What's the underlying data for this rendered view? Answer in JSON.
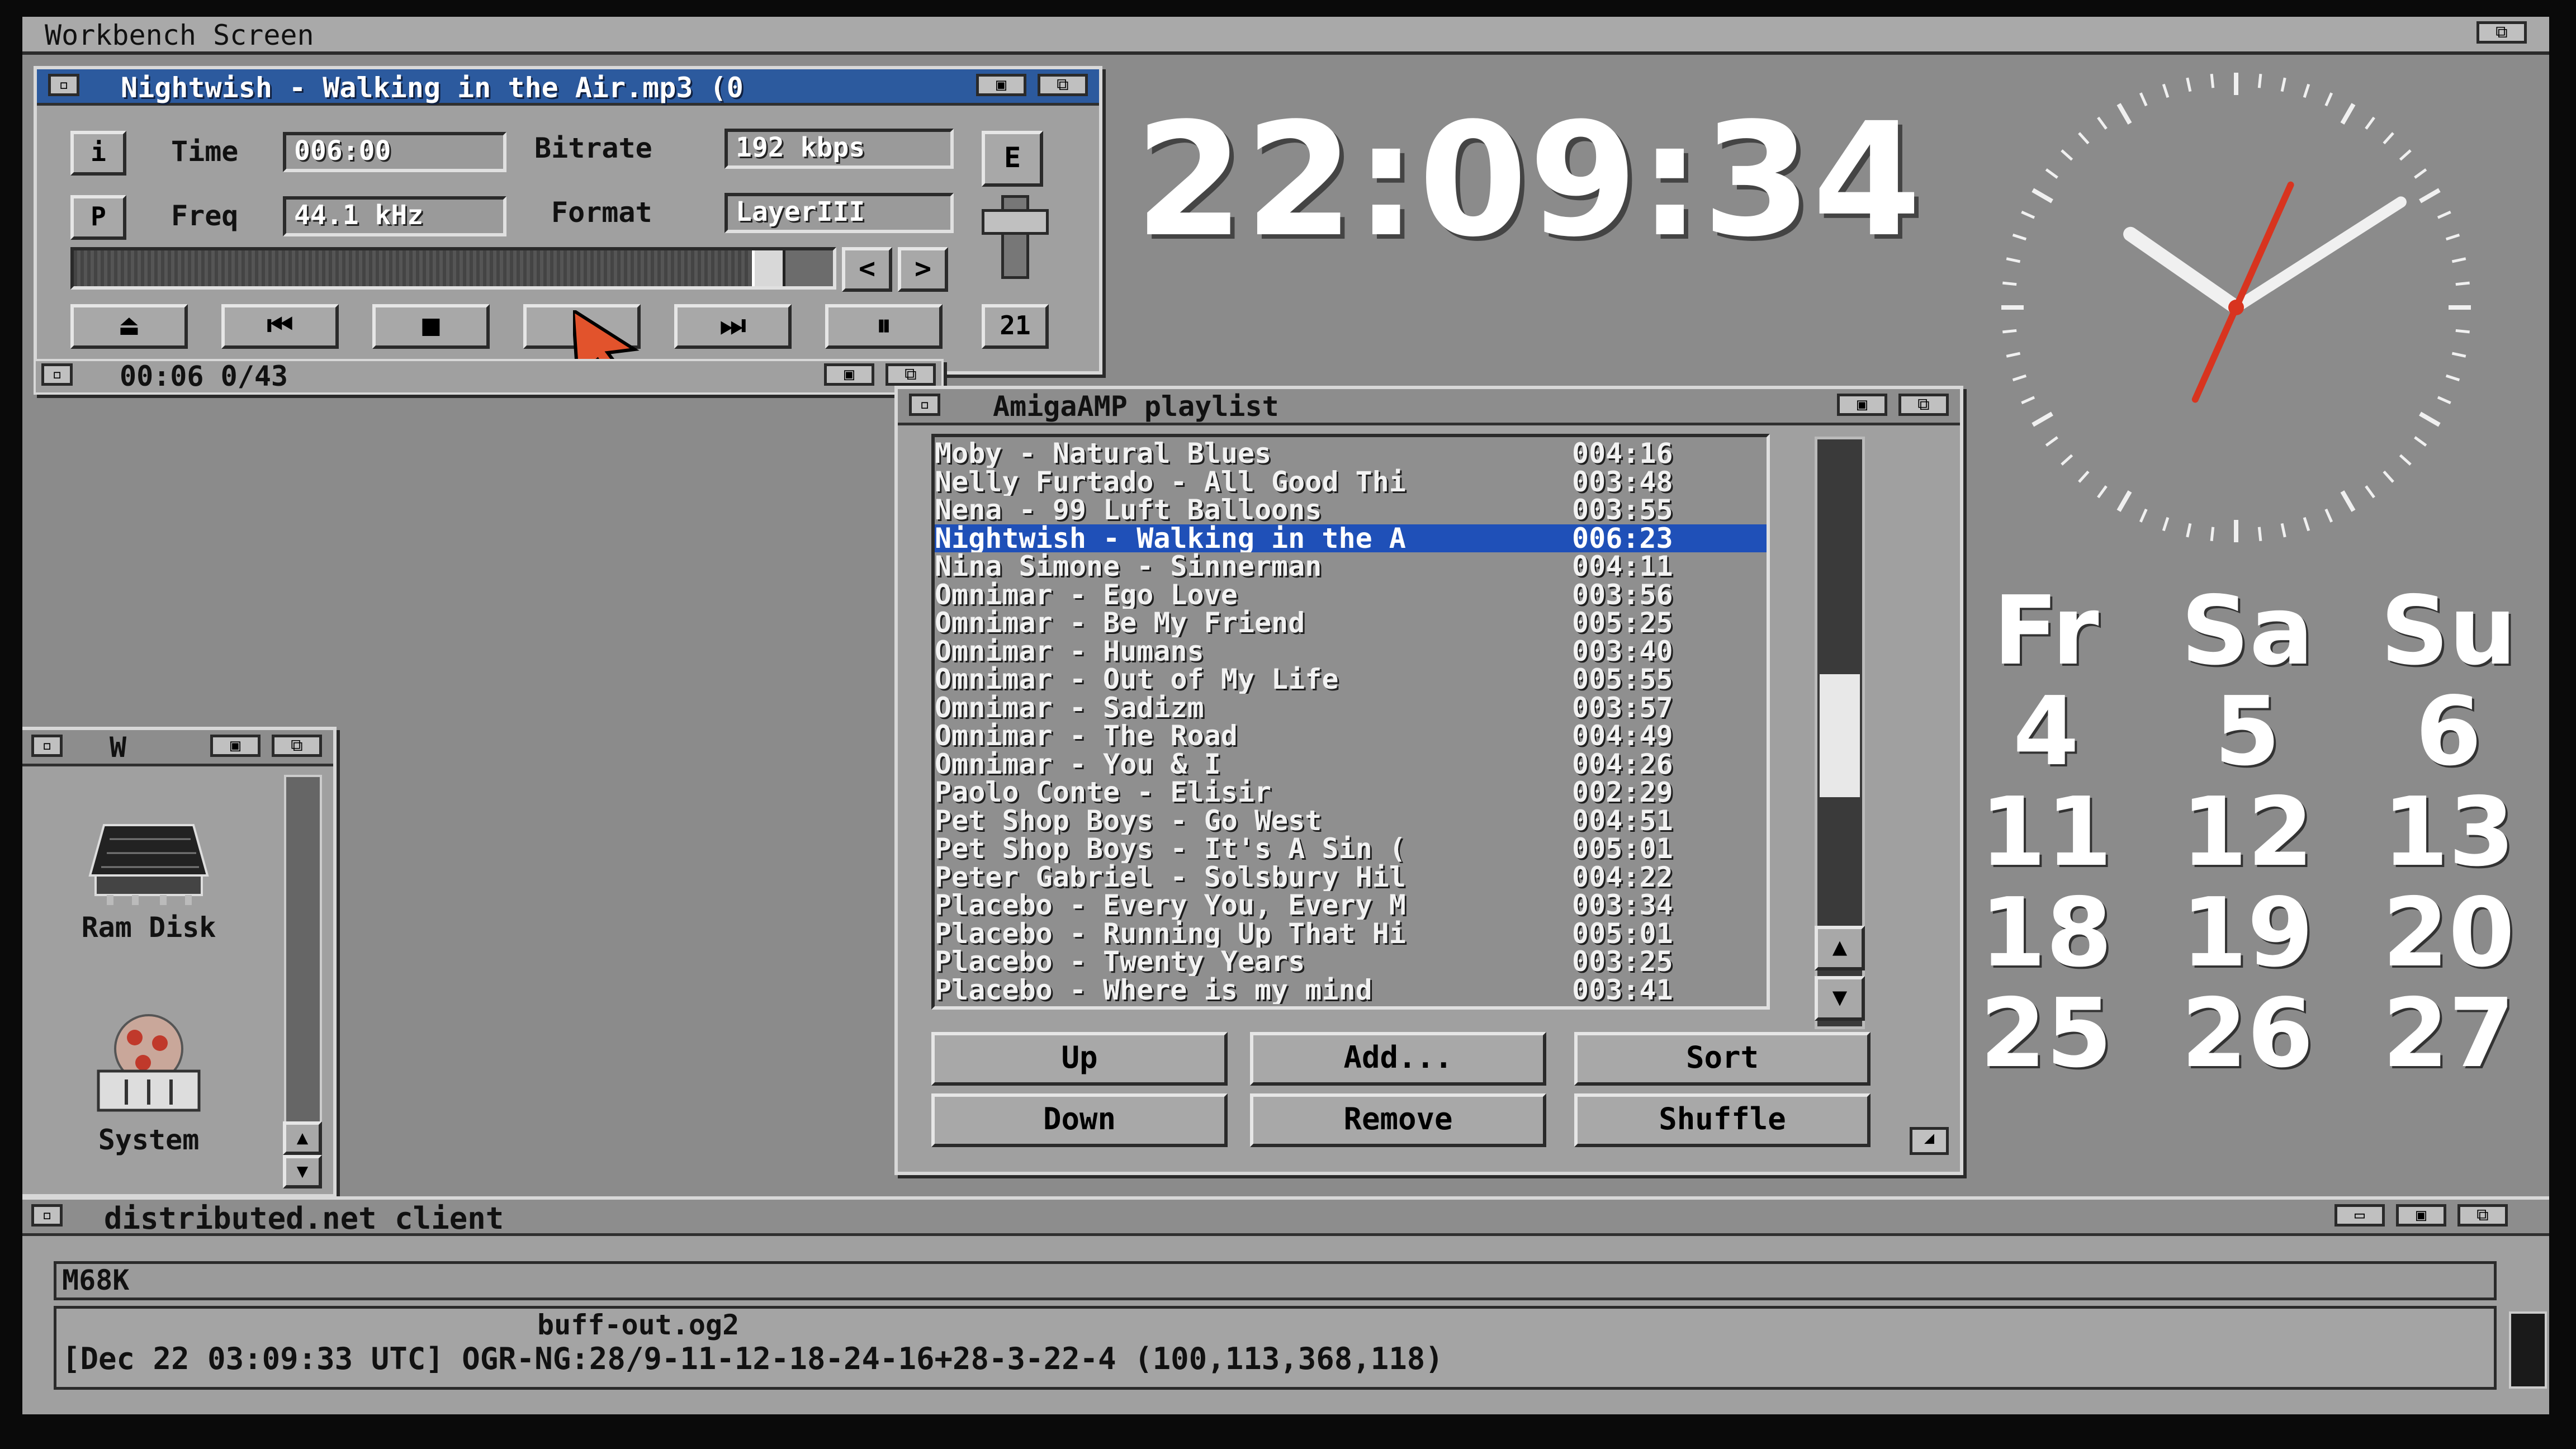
{
  "screen": {
    "title": "Workbench Screen"
  },
  "player": {
    "title": "Nightwish - Walking in the Air.mp3 (0",
    "time_label": "Time",
    "time_value": "006:00",
    "bitrate_label": "Bitrate",
    "bitrate_value": "192 kbps",
    "freq_label": "Freq",
    "freq_value": "44.1 kHz",
    "format_label": "Format",
    "format_value": "LayerIII",
    "info_button": "i",
    "playlist_button": "P",
    "eq_button": "E",
    "prev_small": "<",
    "next_small": ">",
    "mode_button": "21",
    "seek_fraction": 0.93,
    "status_text": "00:06 0/43"
  },
  "clock": {
    "digital_time": "22:09:34",
    "analog": {
      "hours": 22,
      "minutes": 9,
      "seconds": 34
    }
  },
  "calendar": {
    "headers": [
      "Fr",
      "Sa",
      "Su"
    ],
    "weeks": [
      [
        "4",
        "5",
        "6"
      ],
      [
        "11",
        "12",
        "13"
      ],
      [
        "18",
        "19",
        "20"
      ],
      [
        "25",
        "26",
        "27"
      ]
    ]
  },
  "playlist": {
    "title": "AmigaAMP playlist",
    "items": [
      {
        "title": "Moby - Natural Blues",
        "duration": "004:16"
      },
      {
        "title": "Nelly Furtado - All Good Thi",
        "duration": "003:48"
      },
      {
        "title": "Nena - 99 Luft Balloons",
        "duration": "003:55"
      },
      {
        "title": "Nightwish - Walking in the A",
        "duration": "006:23",
        "selected": true
      },
      {
        "title": "Nina Simone - Sinnerman",
        "duration": "004:11"
      },
      {
        "title": "Omnimar - Ego Love",
        "duration": "003:56"
      },
      {
        "title": "Omnimar - Be My Friend",
        "duration": "005:25"
      },
      {
        "title": "Omnimar - Humans",
        "duration": "003:40"
      },
      {
        "title": "Omnimar - Out of My Life",
        "duration": "005:55"
      },
      {
        "title": "Omnimar - Sadizm",
        "duration": "003:57"
      },
      {
        "title": "Omnimar - The Road",
        "duration": "004:49"
      },
      {
        "title": "Omnimar - You & I",
        "duration": "004:26"
      },
      {
        "title": "Paolo Conte - Elisir",
        "duration": "002:29"
      },
      {
        "title": "Pet Shop Boys - Go West",
        "duration": "004:51"
      },
      {
        "title": "Pet Shop Boys - It's A Sin (",
        "duration": "005:01"
      },
      {
        "title": "Peter Gabriel - Solsbury Hil",
        "duration": "004:22"
      },
      {
        "title": "Placebo - Every You, Every M",
        "duration": "003:34"
      },
      {
        "title": "Placebo - Running Up That Hi",
        "duration": "005:01"
      },
      {
        "title": "Placebo - Twenty Years",
        "duration": "003:25"
      },
      {
        "title": "Placebo - Where is my mind",
        "duration": "003:41"
      }
    ],
    "buttons": {
      "up": "Up",
      "add": "Add...",
      "sort": "Sort",
      "down": "Down",
      "remove": "Remove",
      "shuffle": "Shuffle"
    }
  },
  "drawer": {
    "title_letter": "W",
    "icons": [
      {
        "label": "Ram Disk",
        "icon": "ram-disk-icon"
      },
      {
        "label": "System",
        "icon": "system-disk-icon"
      }
    ]
  },
  "dnet": {
    "title": "distributed.net client",
    "cpu": "M68K",
    "line1": "buff-out.og2",
    "line2": "[Dec 22 03:09:33 UTC] OGR-NG:28/9-11-12-18-24-16+28-3-22-4 (100,113,368,118)"
  },
  "colors": {
    "desktop": "#8b8b8b",
    "active_title": "#2c5a9e",
    "selection": "#1f50b8",
    "clock_hand": "#d8341f"
  }
}
